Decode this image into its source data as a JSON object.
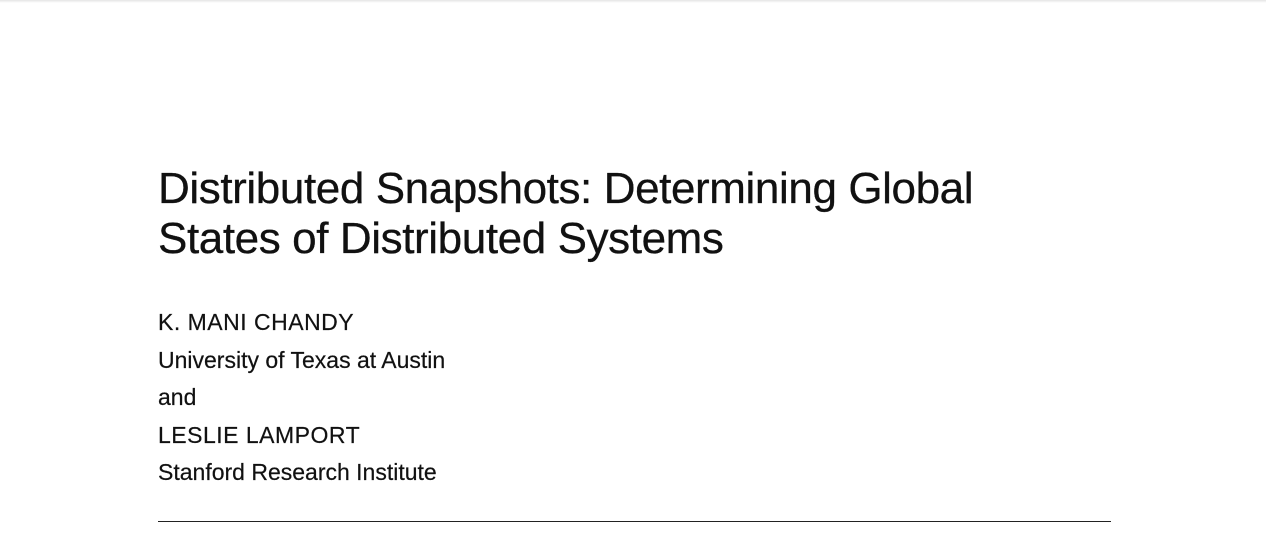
{
  "paper": {
    "title_line_1": "Distributed Snapshots: Determining Global",
    "title_line_2": "States of Distributed Systems",
    "authors": [
      {
        "name": "K. MANI CHANDY",
        "affiliation": "University of Texas at Austin"
      },
      {
        "name": "LESLIE LAMPORT",
        "affiliation": "Stanford Research Institute"
      }
    ],
    "conjunction": "and"
  }
}
